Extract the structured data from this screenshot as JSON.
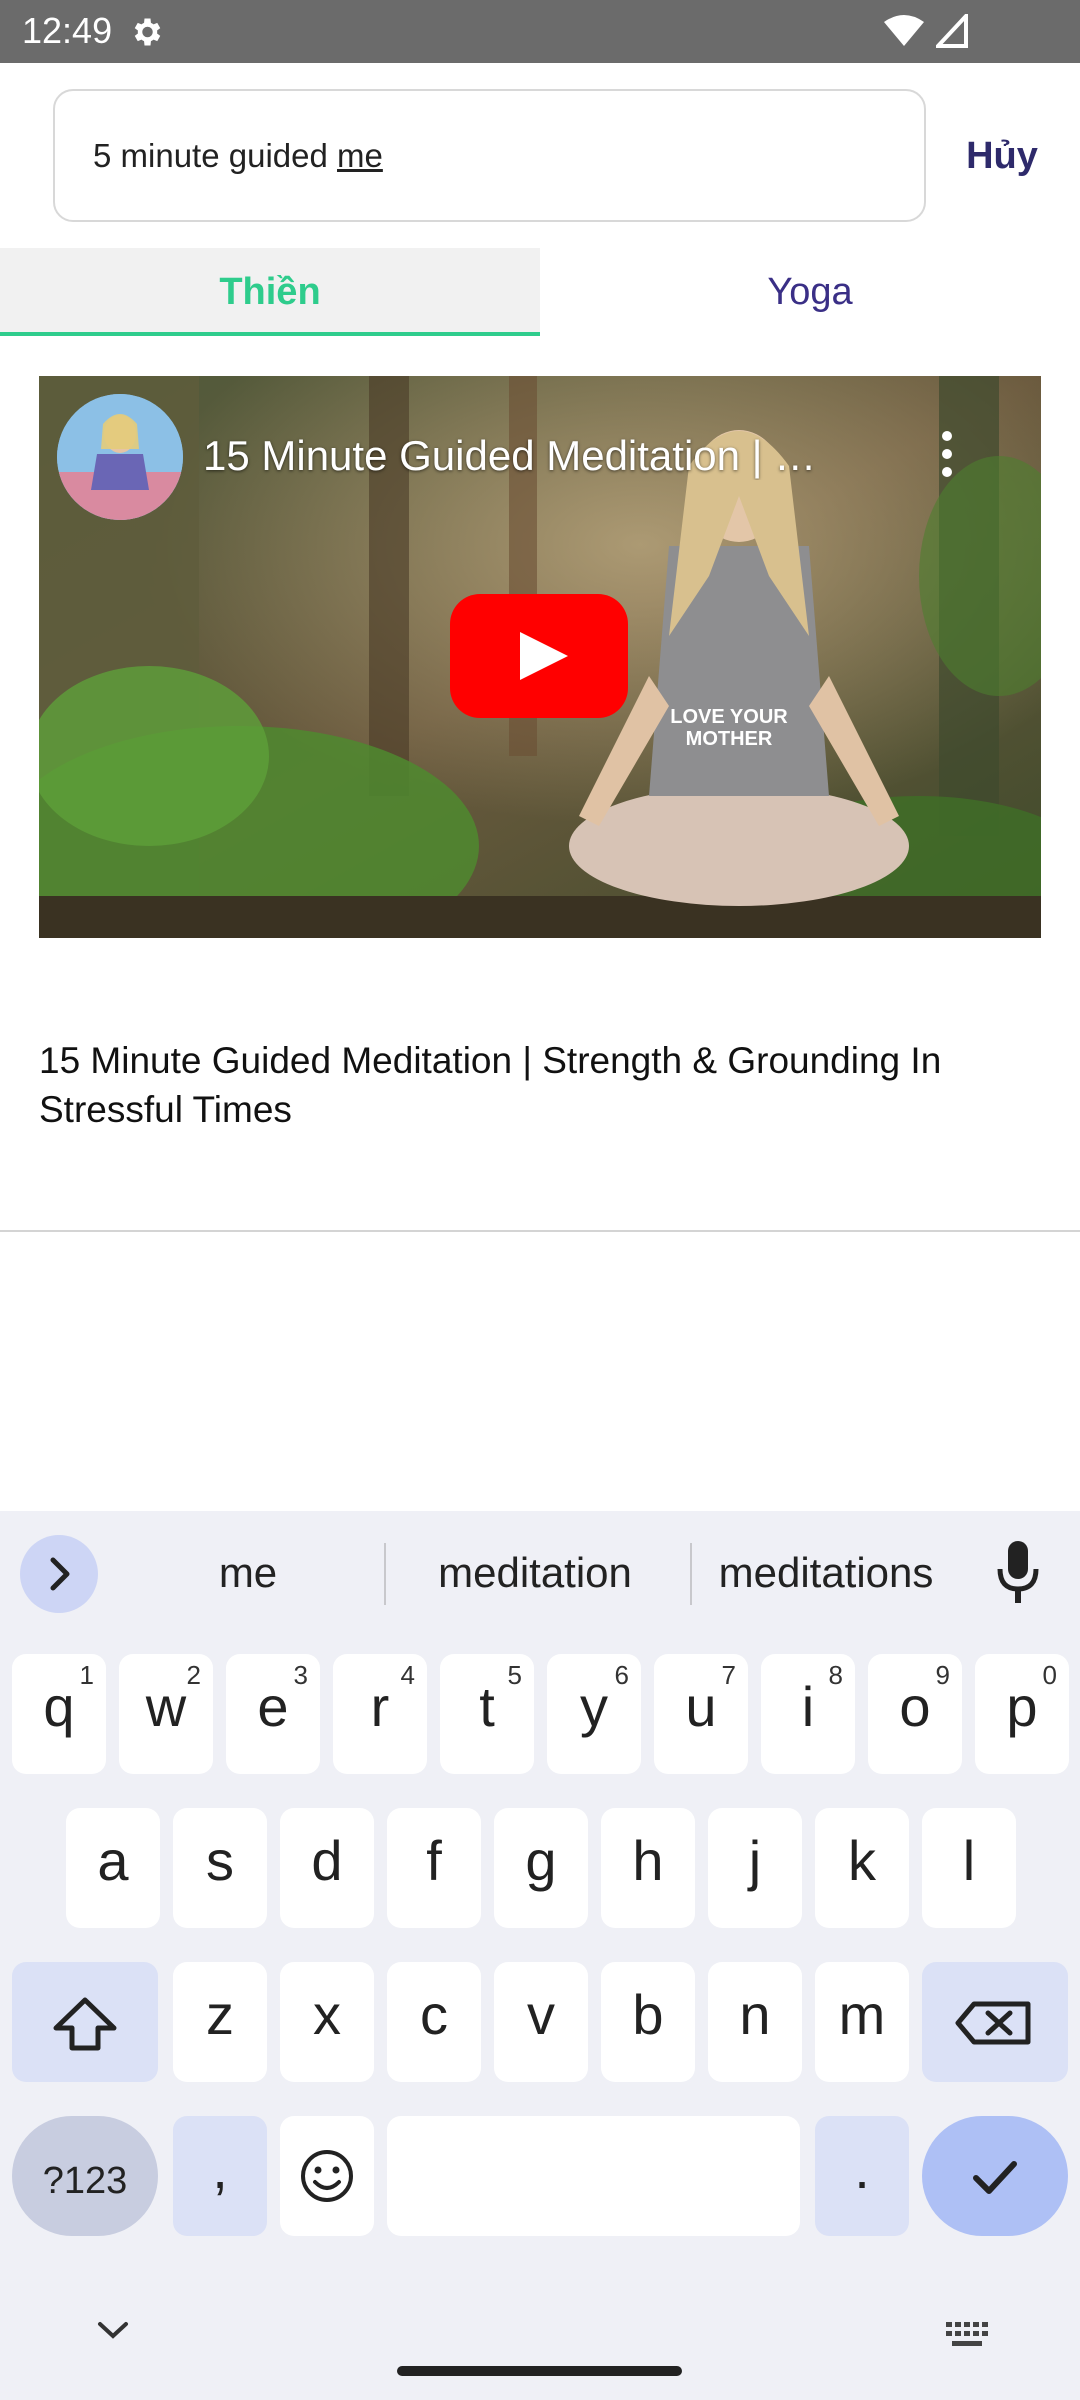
{
  "status_bar": {
    "time": "12:49"
  },
  "search": {
    "text_prefix": "5 minute guided ",
    "text_composing": "me",
    "cancel_label": "Hủy"
  },
  "tabs": [
    {
      "label": "Thiền",
      "active": true
    },
    {
      "label": "Yoga",
      "active": false
    }
  ],
  "video": {
    "overlay_title": "15 Minute Guided Meditation | …",
    "shirt_text": "LOVE YOUR MOTHER",
    "title": "15 Minute Guided Meditation | Strength & Grounding In Stressful Times"
  },
  "keyboard": {
    "suggestions": [
      "me",
      "meditation",
      "meditations"
    ],
    "row1": [
      {
        "k": "q",
        "n": "1"
      },
      {
        "k": "w",
        "n": "2"
      },
      {
        "k": "e",
        "n": "3"
      },
      {
        "k": "r",
        "n": "4"
      },
      {
        "k": "t",
        "n": "5"
      },
      {
        "k": "y",
        "n": "6"
      },
      {
        "k": "u",
        "n": "7"
      },
      {
        "k": "i",
        "n": "8"
      },
      {
        "k": "o",
        "n": "9"
      },
      {
        "k": "p",
        "n": "0"
      }
    ],
    "row2": [
      "a",
      "s",
      "d",
      "f",
      "g",
      "h",
      "j",
      "k",
      "l"
    ],
    "row3": [
      "z",
      "x",
      "c",
      "v",
      "b",
      "n",
      "m"
    ],
    "symbols_label": "?123",
    "comma_label": ",",
    "period_label": "."
  },
  "colors": {
    "accent_green": "#2ecc8c",
    "brand_purple": "#2e2a6b",
    "keyboard_bg": "#eff0f6",
    "youtube_red": "#ff0000"
  }
}
